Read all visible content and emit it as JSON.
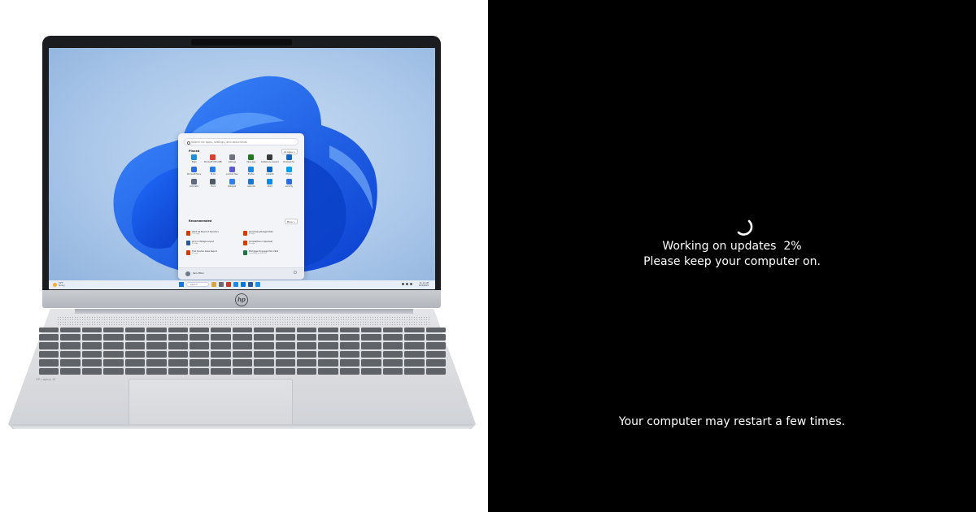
{
  "laptop": {
    "brand_logo": "hp",
    "start_menu": {
      "search_placeholder": "Search for apps, settings, and documents",
      "pinned_label": "Pinned",
      "all_apps_label": "All apps >",
      "pinned_apps": [
        {
          "label": "Edge",
          "color": "#1b8fe0"
        },
        {
          "label": "Microsoft 365 (Office)",
          "color": "#d8412f"
        },
        {
          "label": "Settings",
          "color": "#6b7280"
        },
        {
          "label": "Xbox App",
          "color": "#1f7a1f"
        },
        {
          "label": "Solitaire & Casual Games",
          "color": "#3a3a3a"
        },
        {
          "label": "Pinterest for",
          "color": "#1565c0"
        },
        {
          "label": "Microsoft Store",
          "color": "#2b6de0"
        },
        {
          "label": "To Do",
          "color": "#2a7be4"
        },
        {
          "label": "Luminar Neo",
          "color": "#5a5ad8"
        },
        {
          "label": "Photos",
          "color": "#1e88e5"
        },
        {
          "label": "LinkedIn",
          "color": "#0a66c2"
        },
        {
          "label": "Photos",
          "color": "#00a1f1"
        },
        {
          "label": "Calculator",
          "color": "#5f6b7a"
        },
        {
          "label": "Clock",
          "color": "#505a66"
        },
        {
          "label": "Notepad",
          "color": "#2f80ed"
        },
        {
          "label": "Calendar",
          "color": "#1976d2"
        },
        {
          "label": "Paint",
          "color": "#0d8ae6"
        },
        {
          "label": "Security",
          "color": "#2d6cdf"
        }
      ],
      "recommended_label": "Recommended",
      "more_label": "More >",
      "recommended": [
        {
          "title": "2023 Q4 Board of Directors",
          "sub": "17m ago",
          "color": "#d83b01"
        },
        {
          "title": "Advertising Budget 2022",
          "sub": "1h ago",
          "color": "#d83b01"
        },
        {
          "title": "Jenny's Wedgie Layout",
          "sub": "2h ago",
          "color": "#2b579a"
        },
        {
          "title": "Competitive in Spaceset",
          "sub": "5h ago",
          "color": "#d83b01"
        },
        {
          "title": "First Quarter Sales Report",
          "sub": "6h ago",
          "color": "#d83b01"
        },
        {
          "title": "Mortgage Proposals Plan 2022",
          "sub": "Yesterday at 4:24 PM",
          "color": "#217346"
        }
      ],
      "user_name": "Sara Miller"
    },
    "taskbar": {
      "weather": "74°F\nSunny",
      "search_label": "Search",
      "apps": [
        "#d9a441",
        "#6b6b6b",
        "#c0392b",
        "#1e88e5",
        "#0078d4",
        "#2b579a",
        "#1b8fe0"
      ],
      "clock": "11:11 AM\n10/2/2024"
    },
    "model_label": "HP Laptop 15"
  },
  "update_screen": {
    "status_prefix": "Working on updates  ",
    "percent": "2%",
    "keep_on": "Please keep your computer on.",
    "restart_note": "Your computer may restart a few times."
  }
}
